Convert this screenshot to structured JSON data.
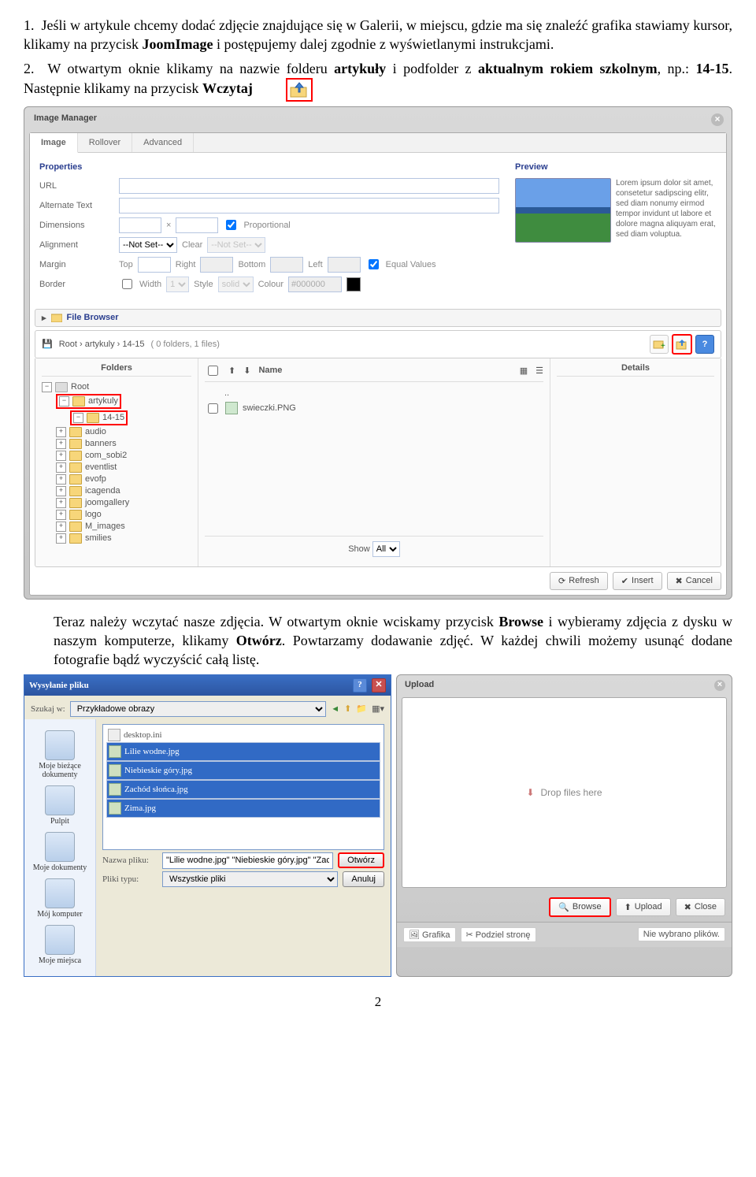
{
  "instructions": {
    "p1_pre": "1.  Jeśli w artykule chcemy dodać zdjęcie znajdujące się w Galerii, w miejscu, gdzie ma się znaleźć grafika stawiamy kursor, klikamy na przycisk ",
    "p1_b1": "JoomImage",
    "p1_post": " i postępujemy dalej zgodnie z wyświetlanymi instrukcjami.",
    "p2_pre": "2.  W otwartym oknie klikamy na nazwie folderu ",
    "p2_b1": "artykuły",
    "p2_mid1": " i podfolder z ",
    "p2_b2": "aktualnym rokiem szkolnym",
    "p2_mid2": ", np.: ",
    "p2_b3": "14-15",
    "p2_mid3": ". Następnie klikamy na przycisk ",
    "p2_b4": "Wczytaj",
    "p3_pre": "Teraz należy wczytać nasze zdjęcia. W otwartym oknie wciskamy przycisk ",
    "p3_b1": "Browse",
    "p3_mid": " i wybieramy zdjęcia z dysku w naszym komputerze, klikamy ",
    "p3_b2": "Otwórz",
    "p3_post": ". Powtarzamy dodawanie zdjęć. W każdej chwili możemy usunąć dodane fotografie bądź wyczyścić całą listę."
  },
  "image_manager": {
    "title": "Image Manager",
    "tabs": [
      "Image",
      "Rollover",
      "Advanced"
    ],
    "section_properties": "Properties",
    "section_preview": "Preview",
    "labels": {
      "url": "URL",
      "alt": "Alternate Text",
      "dim": "Dimensions",
      "prop": "Proportional",
      "align": "Alignment",
      "clear": "Clear",
      "margin": "Margin",
      "top": "Top",
      "right": "Right",
      "bottom": "Bottom",
      "left": "Left",
      "equal": "Equal Values",
      "border": "Border",
      "width": "Width",
      "style": "Style",
      "colour": "Colour"
    },
    "values": {
      "align": "--Not Set--",
      "clear": "--Not Set--",
      "border_width": "1",
      "border_style": "solid",
      "colour": "#000000"
    },
    "lorem": "Lorem ipsum dolor sit amet, consetetur sadipscing elitr, sed diam nonumy eirmod tempor invidunt ut labore et dolore magna aliquyam erat, sed diam voluptua.",
    "file_browser": {
      "title": "File Browser",
      "breadcrumb": "Root › artykuly › 14-15",
      "stats": "( 0 folders, 1 files)",
      "col_folders": "Folders",
      "col_name": "Name",
      "col_details": "Details",
      "root": "Root",
      "folders": [
        "artykuly",
        "14-15",
        "audio",
        "banners",
        "com_sobi2",
        "eventlist",
        "evofp",
        "icagenda",
        "joomgallery",
        "logo",
        "M_images",
        "smilies"
      ],
      "dotdot": "..",
      "file": "swieczki.PNG",
      "show": "Show",
      "show_val": "All",
      "refresh": "Refresh",
      "insert": "Insert",
      "cancel": "Cancel"
    }
  },
  "file_dialog": {
    "title": "Wysyłanie pliku",
    "lookin": "Szukaj w:",
    "lookin_val": "Przykładowe obrazy",
    "side": [
      "Moje bieżące dokumenty",
      "Pulpit",
      "Moje dokumenty",
      "Mój komputer",
      "Moje miejsca"
    ],
    "files": [
      "desktop.ini",
      "Lilie wodne.jpg",
      "Niebieskie góry.jpg",
      "Zachód słońca.jpg",
      "Zima.jpg"
    ],
    "name_label": "Nazwa pliku:",
    "name_val": "\"Lilie wodne.jpg\" \"Niebieskie góry.jpg\" \"Zachó",
    "type_label": "Pliki typu:",
    "type_val": "Wszystkie pliki",
    "open": "Otwórz",
    "cancel": "Anuluj"
  },
  "upload": {
    "title": "Upload",
    "drop": "Drop files here",
    "browse": "Browse",
    "upload": "Upload",
    "close": "Close",
    "status_left": "Grafika",
    "status_mid": "Podziel stronę",
    "status_right": "Nie wybrano plików."
  },
  "page_number": "2"
}
